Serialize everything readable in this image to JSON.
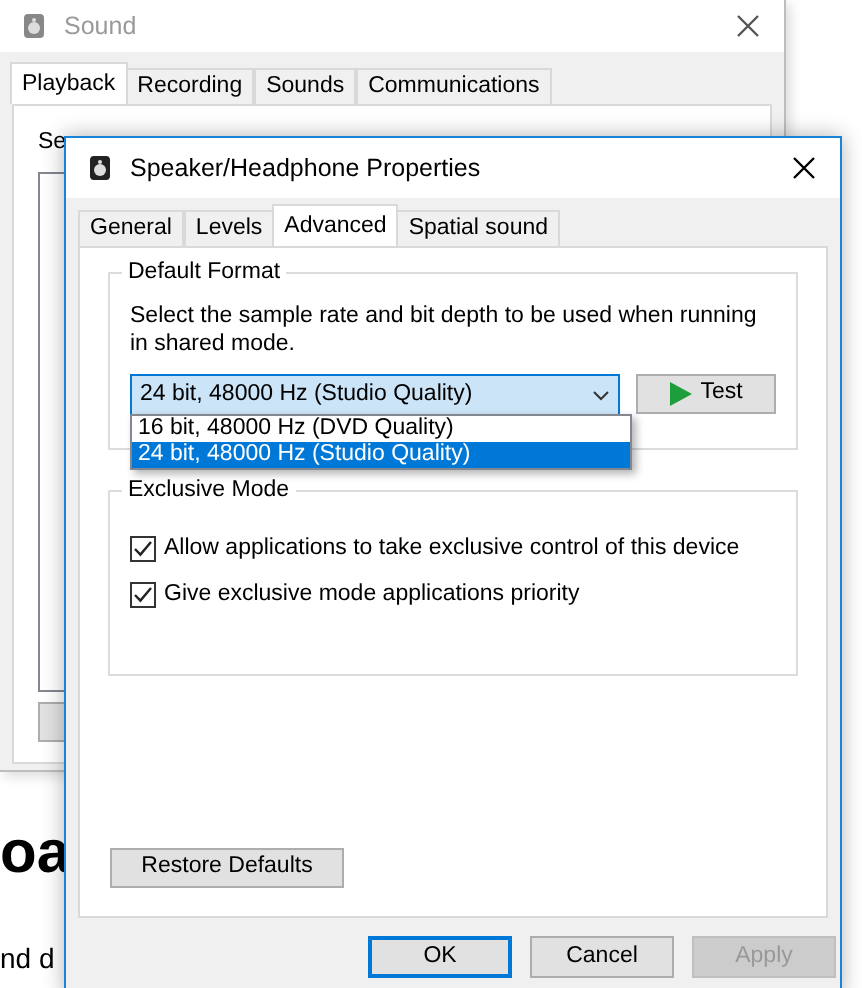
{
  "background_page": {
    "heading_fragment": "oa",
    "text_fragment": "nd d"
  },
  "sound_window": {
    "title": "Sound",
    "tabs": [
      {
        "label": "Playback",
        "selected": true
      },
      {
        "label": "Recording",
        "selected": false
      },
      {
        "label": "Sounds",
        "selected": false
      },
      {
        "label": "Communications",
        "selected": false
      }
    ],
    "intro_text": "Se"
  },
  "properties_dialog": {
    "title": "Speaker/Headphone Properties",
    "tabs": [
      {
        "label": "General",
        "selected": false
      },
      {
        "label": "Levels",
        "selected": false
      },
      {
        "label": "Advanced",
        "selected": true
      },
      {
        "label": "Spatial sound",
        "selected": false
      }
    ],
    "default_format": {
      "heading": "Default Format",
      "description": "Select the sample rate and bit depth to be used when running in shared mode.",
      "select_value": "24 bit, 48000 Hz (Studio Quality)",
      "options": [
        {
          "label": "16 bit, 48000 Hz (DVD Quality)",
          "selected": false
        },
        {
          "label": "24 bit, 48000 Hz (Studio Quality)",
          "selected": true
        }
      ],
      "test_button": "Test"
    },
    "exclusive_mode": {
      "heading": "Exclusive Mode",
      "options": [
        {
          "label": "Allow applications to take exclusive control of this device",
          "checked": true
        },
        {
          "label": "Give exclusive mode applications priority",
          "checked": true
        }
      ]
    },
    "restore_button": "Restore Defaults",
    "buttons": [
      {
        "label": "OK",
        "kind": "default",
        "disabled": false
      },
      {
        "label": "Cancel",
        "kind": "normal",
        "disabled": false
      },
      {
        "label": "Apply",
        "kind": "normal",
        "disabled": true
      }
    ]
  }
}
